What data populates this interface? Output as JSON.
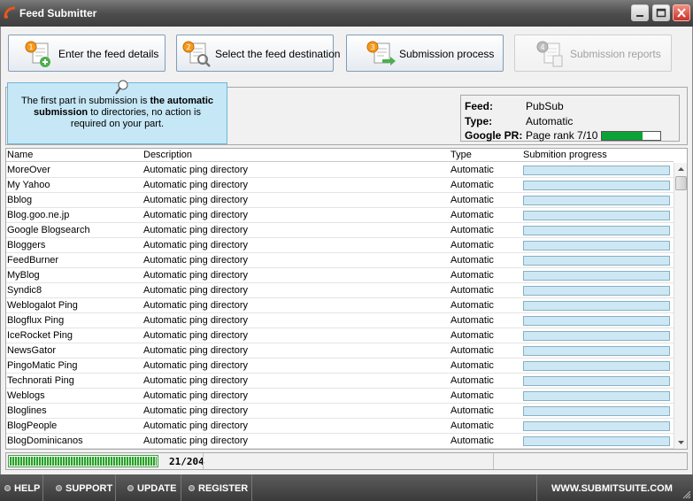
{
  "window": {
    "title": "Feed Submitter"
  },
  "steps": [
    {
      "number": "1",
      "label": "Enter the feed details",
      "enabled": true
    },
    {
      "number": "2",
      "label": "Select the feed destination",
      "enabled": true
    },
    {
      "number": "3",
      "label": "Submission process",
      "enabled": true
    },
    {
      "number": "4",
      "label": "Submission reports",
      "enabled": false
    }
  ],
  "tooltip": {
    "text_before": "The first part in submission is ",
    "bold": "the automatic submission",
    "text_after": " to directories, no action is required on your part."
  },
  "feed_info": {
    "feed_label": "Feed:",
    "feed_value": "PubSub",
    "type_label": "Type:",
    "type_value": "Automatic",
    "pr_label": "Google PR:",
    "pr_value": "Page rank 7/10",
    "pr_fraction": 0.7
  },
  "table": {
    "columns": [
      "Name",
      "Description",
      "Type",
      "Submition progress"
    ],
    "rows": [
      {
        "name": "MoreOver",
        "description": "Automatic ping directory",
        "type": "Automatic"
      },
      {
        "name": "My Yahoo",
        "description": "Automatic ping directory",
        "type": "Automatic"
      },
      {
        "name": "Bblog",
        "description": "Automatic ping directory",
        "type": "Automatic"
      },
      {
        "name": "Blog.goo.ne.jp",
        "description": "Automatic ping directory",
        "type": "Automatic"
      },
      {
        "name": "Google Blogsearch",
        "description": "Automatic ping directory",
        "type": "Automatic"
      },
      {
        "name": "Bloggers",
        "description": "Automatic ping directory",
        "type": "Automatic"
      },
      {
        "name": "FeedBurner",
        "description": "Automatic ping directory",
        "type": "Automatic"
      },
      {
        "name": "MyBlog",
        "description": "Automatic ping directory",
        "type": "Automatic"
      },
      {
        "name": "Syndic8",
        "description": "Automatic ping directory",
        "type": "Automatic"
      },
      {
        "name": "Weblogalot Ping",
        "description": "Automatic ping directory",
        "type": "Automatic"
      },
      {
        "name": "Blogflux Ping",
        "description": "Automatic ping directory",
        "type": "Automatic"
      },
      {
        "name": "IceRocket Ping",
        "description": "Automatic ping directory",
        "type": "Automatic"
      },
      {
        "name": "NewsGator",
        "description": "Automatic ping directory",
        "type": "Automatic"
      },
      {
        "name": "PingoMatic Ping",
        "description": "Automatic ping directory",
        "type": "Automatic"
      },
      {
        "name": "Technorati Ping",
        "description": "Automatic ping directory",
        "type": "Automatic"
      },
      {
        "name": "Weblogs",
        "description": "Automatic ping directory",
        "type": "Automatic"
      },
      {
        "name": "Bloglines",
        "description": "Automatic ping directory",
        "type": "Automatic"
      },
      {
        "name": "BlogPeople",
        "description": "Automatic ping directory",
        "type": "Automatic"
      },
      {
        "name": "BlogDominicanos",
        "description": "Automatic ping directory",
        "type": "Automatic"
      }
    ]
  },
  "status": {
    "progress_text": "21/204",
    "overall_fraction": 1.0
  },
  "footer": {
    "help": "HELP",
    "support": "SUPPORT",
    "update": "UPDATE",
    "register": "REGISTER",
    "site": "WWW.SUBMITSUITE.COM"
  },
  "colors": {
    "pr_bar": "#0ca336",
    "row_progress": "#cde8f4",
    "overall_progress": "#2aa02a",
    "tooltip_bg": "#c6e7f6"
  }
}
